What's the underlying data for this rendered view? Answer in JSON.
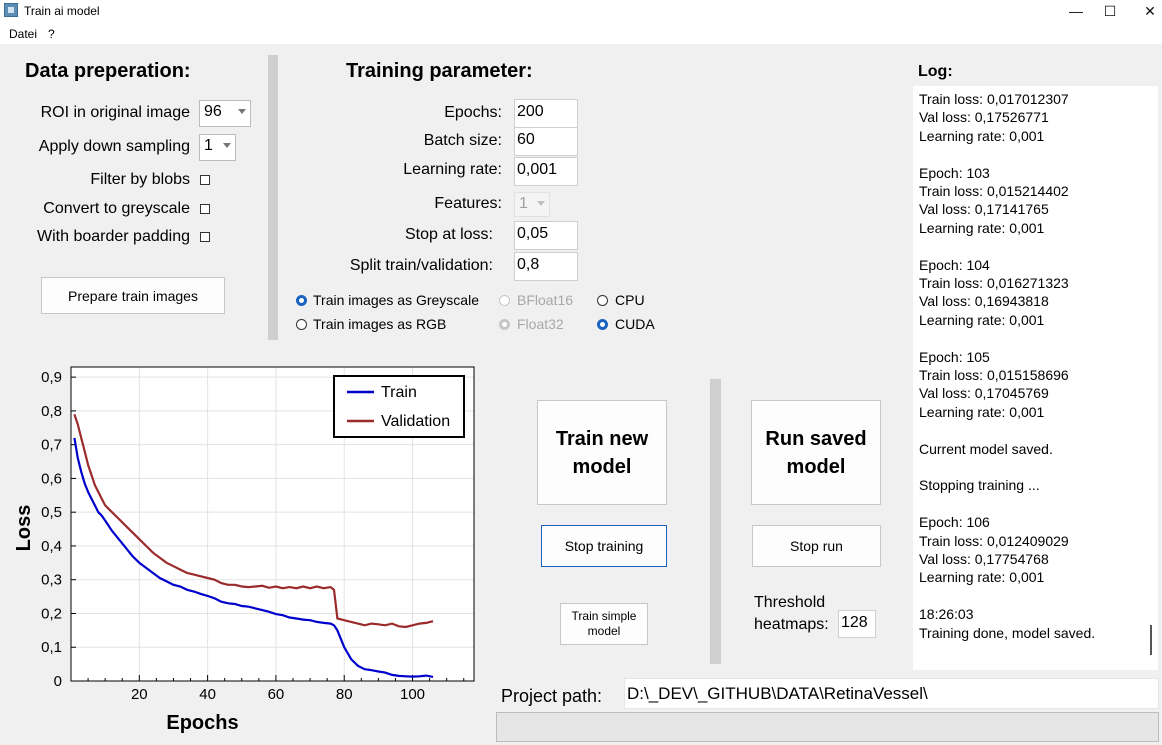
{
  "window": {
    "title": "Train ai model",
    "controls": {
      "minimize": "—",
      "maximize": "☐",
      "close": "✕"
    }
  },
  "menu": {
    "items": [
      "Datei",
      "?"
    ]
  },
  "data_prep": {
    "title": "Data preperation:",
    "roi_label": "ROI in original image",
    "roi_value": "96",
    "downsample_label": "Apply down sampling",
    "downsample_value": "1",
    "filter_blobs_label": "Filter by blobs",
    "filter_blobs_checked": false,
    "greyscale_label": "Convert to greyscale",
    "greyscale_checked": false,
    "padding_label": "With boarder padding",
    "padding_checked": false,
    "prepare_button": "Prepare train images"
  },
  "training_params": {
    "title": "Training parameter:",
    "epochs_label": "Epochs:",
    "epochs_value": "200",
    "batch_label": "Batch size:",
    "batch_value": "60",
    "lr_label": "Learning rate:",
    "lr_value": "0,001",
    "features_label": "Features:",
    "features_value": "1",
    "stop_loss_label": "Stop at loss:",
    "stop_loss_value": "0,05",
    "split_label": "Split train/validation:",
    "split_value": "0,8",
    "image_mode": {
      "greyscale": "Train images as Greyscale",
      "rgb": "Train images as RGB",
      "selected": "greyscale"
    },
    "precision": {
      "bfloat16": "BFloat16",
      "float32": "Float32",
      "selected": "float32",
      "enabled": false
    },
    "device": {
      "cpu": "CPU",
      "cuda": "CUDA",
      "selected": "cuda"
    }
  },
  "log": {
    "title": "Log:",
    "lines": [
      "Train loss: 0,017012307",
      "Val loss: 0,17526771",
      "Learning rate: 0,001",
      "",
      "Epoch: 103",
      "Train loss: 0,015214402",
      "Val loss: 0,17141765",
      "Learning rate: 0,001",
      "",
      "Epoch: 104",
      "Train loss: 0,016271323",
      "Val loss: 0,16943818",
      "Learning rate: 0,001",
      "",
      "Epoch: 105",
      "Train loss: 0,015158696",
      "Val loss: 0,17045769",
      "Learning rate: 0,001",
      "",
      "Current model saved.",
      "",
      "Stopping training ...",
      "",
      "Epoch: 106",
      "Train loss: 0,012409029",
      "Val loss: 0,17754768",
      "Learning rate: 0,001",
      "",
      "18:26:03",
      "Training done, model saved."
    ]
  },
  "actions": {
    "train_new": "Train new model",
    "stop_training": "Stop training",
    "train_simple": "Train simple model",
    "run_saved": "Run saved model",
    "stop_run": "Stop run",
    "threshold_label": "Threshold heatmaps:",
    "threshold_value": "128"
  },
  "project": {
    "label": "Project path:",
    "path": "D:\\_DEV\\_GITHUB\\DATA\\RetinaVessel\\"
  },
  "colors": {
    "accent": "#1a63c2",
    "train": "#0000cc",
    "validation": "#9b2a2a"
  },
  "chart_data": {
    "type": "line",
    "xlabel": "Epochs",
    "ylabel": "Loss",
    "xlim": [
      0,
      118
    ],
    "ylim": [
      0,
      0.93
    ],
    "xticks": [
      20,
      40,
      60,
      80,
      100
    ],
    "yticks": [
      0,
      0.1,
      0.2,
      0.3,
      0.4,
      0.5,
      0.6,
      0.7,
      0.8,
      0.9
    ],
    "ytick_labels": [
      "0",
      "0,1",
      "0,2",
      "0,3",
      "0,4",
      "0,5",
      "0,6",
      "0,7",
      "0,8",
      "0,9"
    ],
    "grid": true,
    "legend": "top-right",
    "x": [
      1,
      2,
      3,
      4,
      5,
      6,
      7,
      8,
      9,
      10,
      12,
      14,
      16,
      18,
      20,
      22,
      24,
      26,
      28,
      30,
      32,
      34,
      36,
      38,
      40,
      42,
      44,
      46,
      48,
      50,
      52,
      54,
      56,
      58,
      60,
      62,
      64,
      66,
      68,
      70,
      72,
      74,
      76,
      77,
      78,
      80,
      82,
      84,
      86,
      88,
      90,
      92,
      94,
      96,
      98,
      100,
      102,
      104,
      106
    ],
    "series": [
      {
        "name": "Train",
        "values": [
          0.72,
          0.66,
          0.62,
          0.585,
          0.56,
          0.54,
          0.52,
          0.5,
          0.49,
          0.475,
          0.445,
          0.42,
          0.395,
          0.37,
          0.35,
          0.335,
          0.32,
          0.305,
          0.295,
          0.285,
          0.28,
          0.27,
          0.265,
          0.258,
          0.252,
          0.245,
          0.235,
          0.23,
          0.228,
          0.222,
          0.22,
          0.215,
          0.21,
          0.205,
          0.198,
          0.195,
          0.188,
          0.185,
          0.182,
          0.18,
          0.175,
          0.172,
          0.17,
          0.165,
          0.15,
          0.1,
          0.065,
          0.045,
          0.035,
          0.032,
          0.028,
          0.025,
          0.018,
          0.015,
          0.014,
          0.013,
          0.014,
          0.016,
          0.012
        ]
      },
      {
        "name": "Validation",
        "values": [
          0.79,
          0.76,
          0.72,
          0.68,
          0.64,
          0.61,
          0.58,
          0.56,
          0.54,
          0.52,
          0.5,
          0.48,
          0.46,
          0.44,
          0.42,
          0.4,
          0.38,
          0.365,
          0.35,
          0.34,
          0.33,
          0.32,
          0.315,
          0.31,
          0.305,
          0.3,
          0.29,
          0.285,
          0.285,
          0.28,
          0.278,
          0.28,
          0.282,
          0.276,
          0.28,
          0.275,
          0.278,
          0.275,
          0.28,
          0.275,
          0.28,
          0.275,
          0.278,
          0.27,
          0.185,
          0.18,
          0.175,
          0.17,
          0.165,
          0.17,
          0.168,
          0.165,
          0.17,
          0.162,
          0.16,
          0.165,
          0.17,
          0.172,
          0.177
        ]
      }
    ]
  }
}
